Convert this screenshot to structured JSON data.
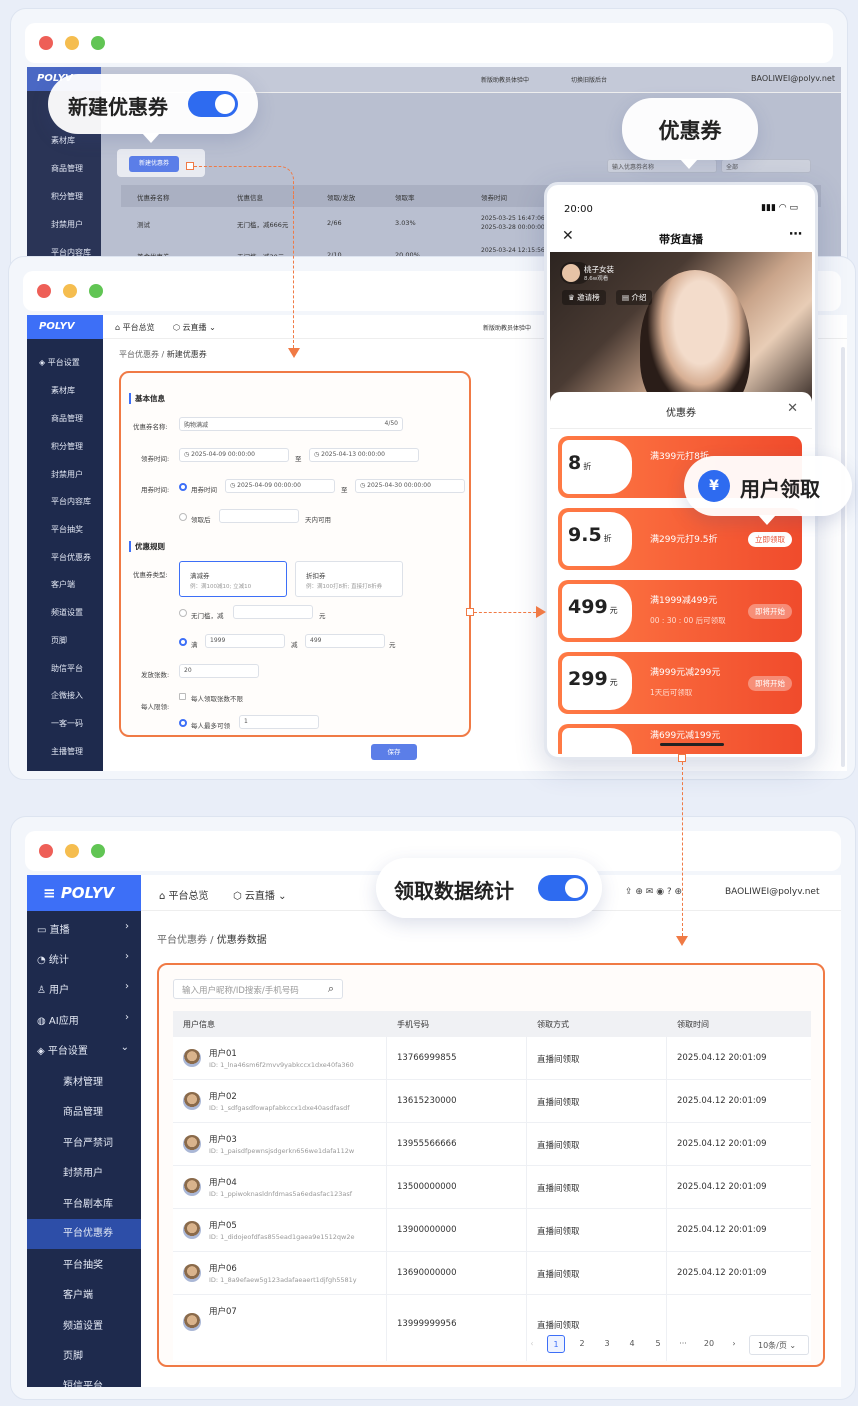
{
  "callouts": {
    "new_coupon": "新建优惠券",
    "coupon": "优惠券",
    "user_claim": "用户领取",
    "stats": "领取数据统计"
  },
  "win1": {
    "logo": "POLYV",
    "top_actions": [
      "新版助教员体验中",
      "切换旧版后台"
    ],
    "account": "BAOLIWEI@polyv.net",
    "sidebar": [
      "素材库",
      "商品管理",
      "积分管理",
      "封禁用户",
      "平台内容库"
    ],
    "new_button": "新建优惠券",
    "search_placeholder": "输入优惠券名称",
    "status_select": "全部",
    "table_headers": [
      "优惠券名称",
      "优惠信息",
      "领取/发放",
      "领取率",
      "领券时间"
    ],
    "rows": [
      {
        "name": "测试",
        "info": "无门槛，减666元",
        "count": "2/66",
        "rate": "3.03%",
        "time1": "2025-03-25 16:47:06",
        "time2": "2025-03-28 00:00:00"
      },
      {
        "name": "美食优惠券",
        "info": "无门槛，减30元",
        "count": "2/10",
        "rate": "20.00%",
        "time1": "2025-03-24 12:15:56",
        "time2": ""
      }
    ]
  },
  "win2": {
    "logo": "POLYV",
    "nav": [
      "平台总览",
      "云直播"
    ],
    "top_action": "新版助教员体验中",
    "sidebar_group": "平台设置",
    "sidebar": [
      "素材库",
      "商品管理",
      "积分管理",
      "封禁用户",
      "平台内容库",
      "平台抽奖",
      "平台优惠券",
      "客户端",
      "频道设置",
      "页脚",
      "助信平台",
      "企微接入",
      "一客一码",
      "主播管理"
    ],
    "breadcrumb": [
      "平台优惠券",
      "新建优惠券"
    ],
    "section_basic": "基本信息",
    "name_label": "优惠券名称:",
    "name_value": "购物满减",
    "name_count": "4/50",
    "claim_time_label": "领券时间:",
    "claim_start": "2025-04-09 00:00:00",
    "to": "至",
    "claim_end": "2025-04-13 00:00:00",
    "use_time_label": "用券时间:",
    "use_time_opt": "用券时间",
    "use_start": "2025-04-09 00:00:00",
    "use_end": "2025-04-30 00:00:00",
    "after_claim": "领取后",
    "days_available": "天内可用",
    "section_rule": "优惠规则",
    "type_label": "优惠券类型:",
    "type1_title": "满减券",
    "type1_example": "例：满100减10; 立减10",
    "type2_title": "折扣券",
    "type2_example": "例：满100打8折; 直接打8折券",
    "no_threshold": "无门槛，减",
    "yuan": "元",
    "full": "满",
    "full_value": "1999",
    "minus": "减",
    "minus_value": "499",
    "issue_label": "发放张数:",
    "issue_value": "20",
    "per_person_label": "每人限领:",
    "no_limit": "每人领取张数不限",
    "max_label": "每人最多可领",
    "max_value": "1",
    "save": "保存"
  },
  "phone": {
    "time": "20:00",
    "title": "带货直播",
    "host": "桃子女装",
    "viewers": "8.6w观看",
    "invite": "邀请榜",
    "intro": "介绍",
    "panel_title": "优惠券",
    "coupons": [
      {
        "big": "8",
        "unit": "折",
        "desc": "满399元打8折",
        "sub": "",
        "btn": "",
        "disabled": false
      },
      {
        "big": "9.5",
        "unit": "折",
        "desc": "满299元打9.5折",
        "sub": "",
        "btn": "立即领取",
        "disabled": false
      },
      {
        "big": "499",
        "unit": "元",
        "desc": "满1999减499元",
        "sub": "00 : 30 : 00  后可领取",
        "btn": "即将开始",
        "disabled": true
      },
      {
        "big": "299",
        "unit": "元",
        "desc": "满999元减299元",
        "sub": "1天后可领取",
        "btn": "即将开始",
        "disabled": true
      },
      {
        "big": "",
        "unit": "",
        "desc": "满699元减199元",
        "sub": "",
        "btn": "",
        "disabled": true
      }
    ]
  },
  "win3": {
    "logo": "POLYV",
    "nav": [
      "平台总览",
      "云直播"
    ],
    "account": "BAOLIWEI@polyv.net",
    "menu": [
      {
        "label": "直播",
        "arrow": "›"
      },
      {
        "label": "统计",
        "arrow": "›"
      },
      {
        "label": "用户",
        "arrow": "›"
      },
      {
        "label": "AI应用",
        "arrow": "›"
      },
      {
        "label": "平台设置",
        "arrow": "⌄"
      }
    ],
    "submenu": [
      "素材管理",
      "商品管理",
      "平台严禁词",
      "封禁用户",
      "平台剧本库",
      "平台优惠券",
      "平台抽奖",
      "客户端",
      "频道设置",
      "页脚",
      "短信平台"
    ],
    "breadcrumb": [
      "平台优惠券",
      "优惠券数据"
    ],
    "search_placeholder": "输入用户昵称/ID搜索/手机号码",
    "headers": [
      "用户信息",
      "手机号码",
      "领取方式",
      "领取时间"
    ],
    "rows": [
      {
        "name": "用户01",
        "id": "ID: 1_lna46sm6f2mvv9yabkccx1dxe40fa360",
        "phone": "13766999855",
        "method": "直播间领取",
        "time": "2025.04.12 20:01:09"
      },
      {
        "name": "用户02",
        "id": "ID: 1_sdfgasdfowapfabkccx1dxe40asdfasdf",
        "phone": "13615230000",
        "method": "直播间领取",
        "time": "2025.04.12 20:01:09"
      },
      {
        "name": "用户03",
        "id": "ID: 1_paisdfpewnsjsdgerkn656we1dafa112w",
        "phone": "13955566666",
        "method": "直播间领取",
        "time": "2025.04.12 20:01:09"
      },
      {
        "name": "用户04",
        "id": "ID: 1_ppiwoknasldnfdmas5a6edasfac123asf",
        "phone": "13500000000",
        "method": "直播间领取",
        "time": "2025.04.12 20:01:09"
      },
      {
        "name": "用户05",
        "id": "ID: 1_didojeofdfas855ead1gaea9e1512qw2e",
        "phone": "13900000000",
        "method": "直播间领取",
        "time": "2025.04.12 20:01:09"
      },
      {
        "name": "用户06",
        "id": "ID: 1_8a9efaew5g123adafaeaert1djfgh5581y",
        "phone": "13690000000",
        "method": "直播间领取",
        "time": "2025.04.12 20:01:09"
      },
      {
        "name": "用户07",
        "id": "",
        "phone": "13999999956",
        "method": "直播间领取",
        "time": ""
      }
    ],
    "pagination": {
      "prev": "‹",
      "pages": [
        "1",
        "2",
        "3",
        "4",
        "5",
        "···",
        "20"
      ],
      "next": "›",
      "size": "10条/页"
    }
  }
}
